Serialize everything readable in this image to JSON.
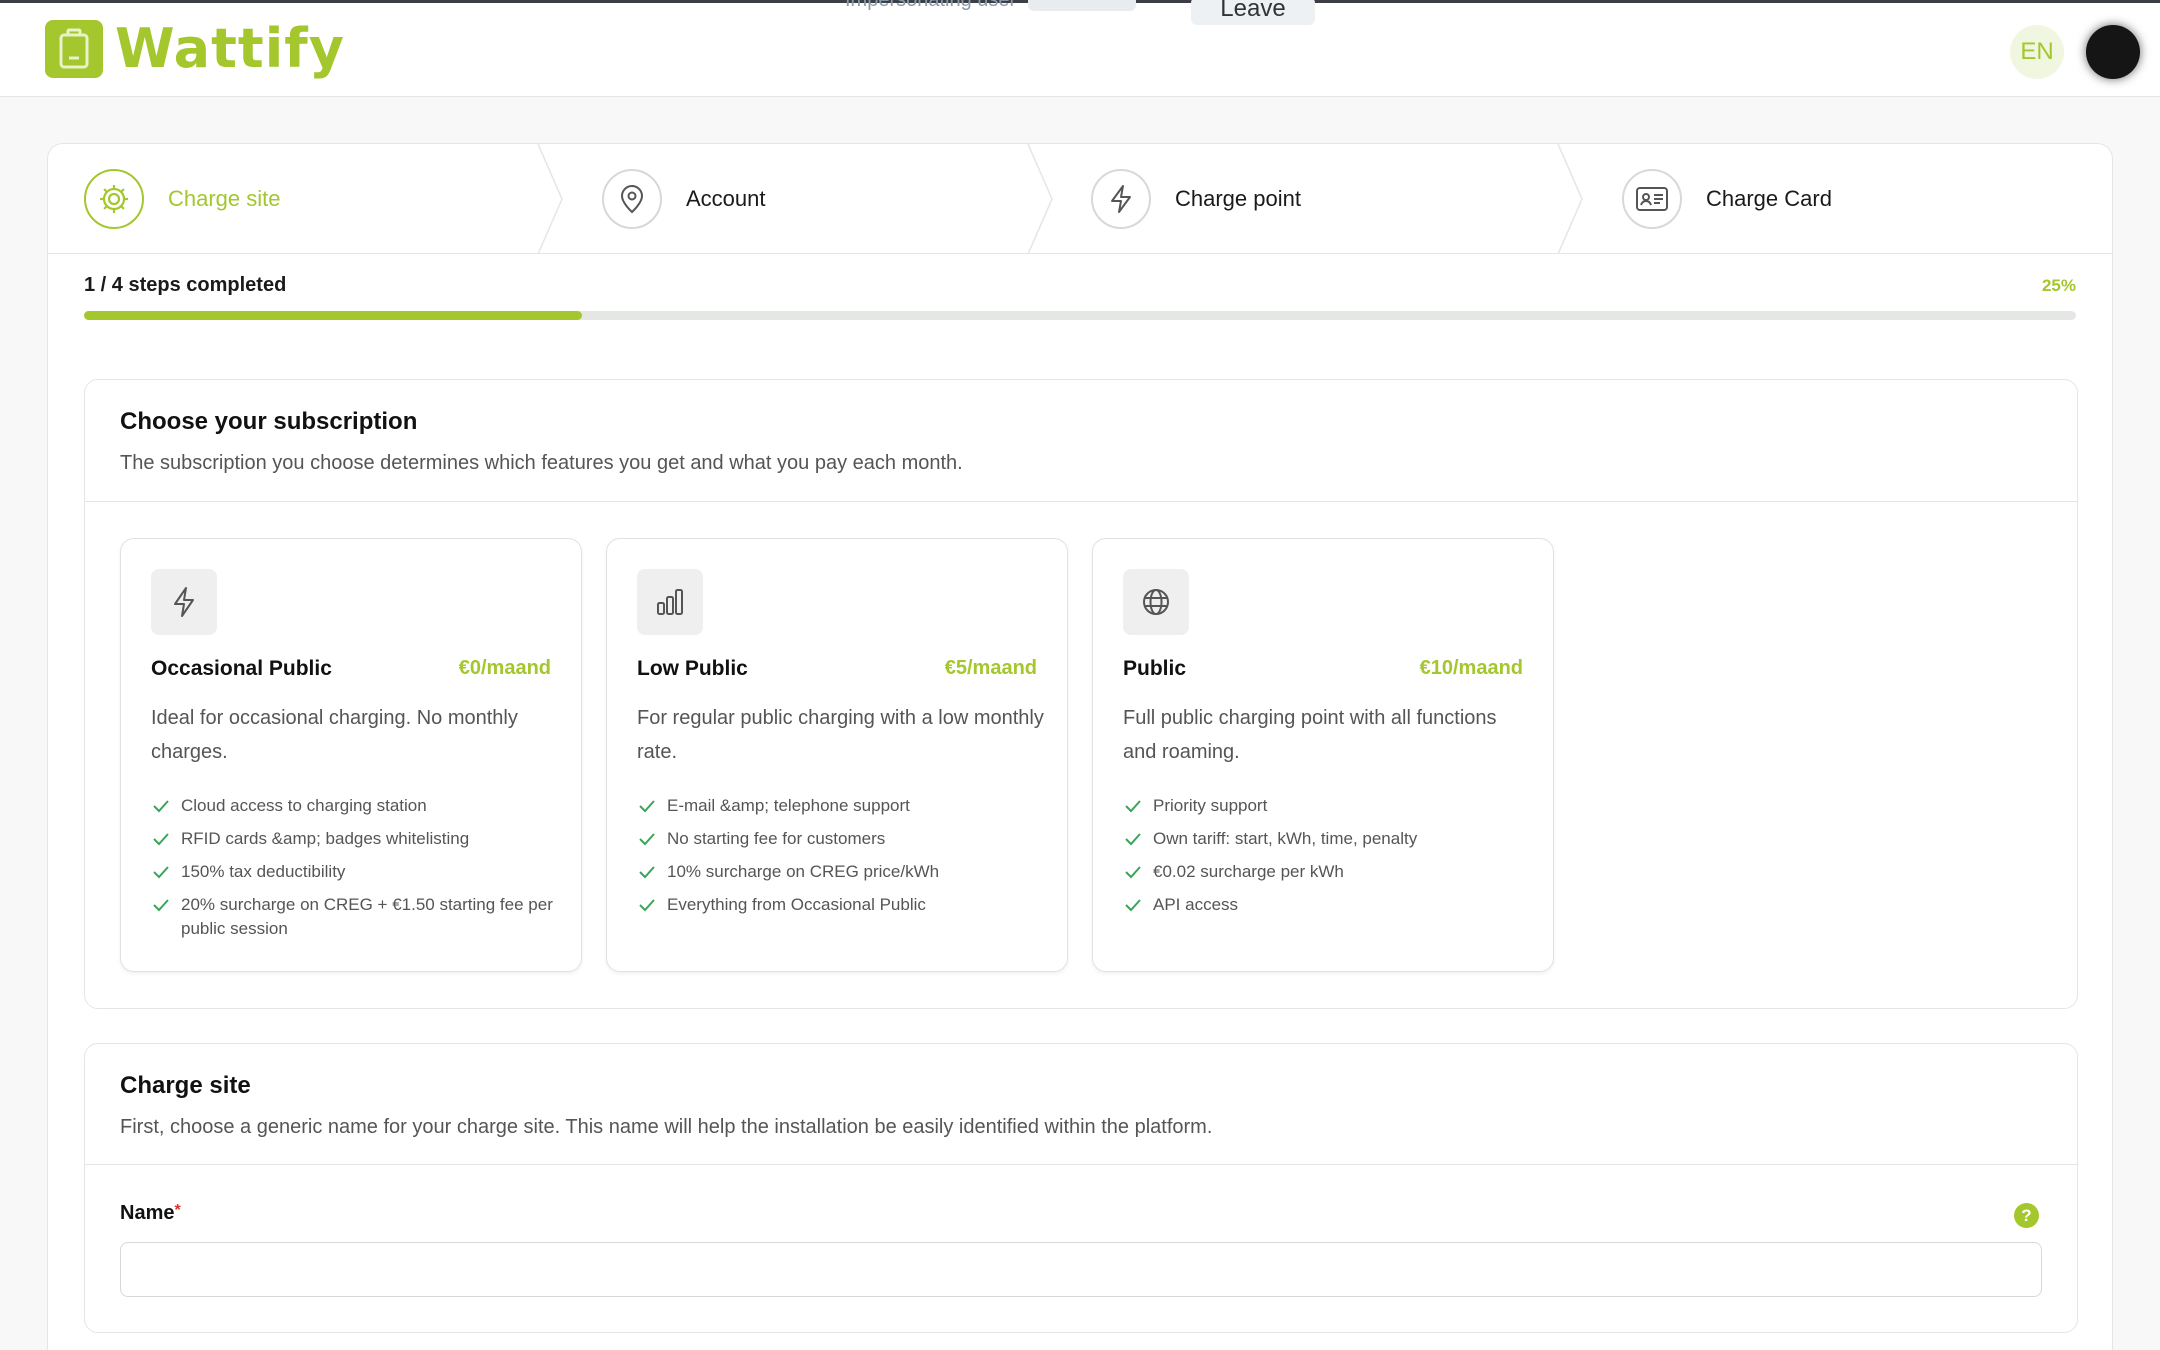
{
  "header": {
    "logo_text": "Wattify",
    "impersonate_text": "Impersonating user",
    "leave_label": "Leave",
    "language": "EN"
  },
  "steps": [
    {
      "label": "Charge site",
      "icon": "gear-icon",
      "active": true
    },
    {
      "label": "Account",
      "icon": "map-pin-icon",
      "active": false
    },
    {
      "label": "Charge point",
      "icon": "lightning-icon",
      "active": false
    },
    {
      "label": "Charge Card",
      "icon": "id-card-icon",
      "active": false
    }
  ],
  "progress": {
    "text": "1 / 4 steps completed",
    "percent_label": "25%",
    "fraction": 0.25
  },
  "subscription": {
    "title": "Choose your subscription",
    "description": "The subscription you choose determines which features you get and what you pay each month.",
    "plans": [
      {
        "name": "Occasional Public",
        "price": "€0/maand",
        "icon": "lightning-icon",
        "description": "Ideal for occasional charging. No monthly charges.",
        "features": [
          "Cloud access to charging station",
          "RFID cards &amp; badges whitelisting",
          "150% tax deductibility",
          "20% surcharge on CREG + €1.50 starting fee per public session"
        ]
      },
      {
        "name": "Low Public",
        "price": "€5/maand",
        "icon": "bar-chart-icon",
        "description": "For regular public charging with a low monthly rate.",
        "features": [
          "E-mail &amp; telephone support",
          "No starting fee for customers",
          "10% surcharge on CREG price/kWh",
          "Everything from Occasional Public"
        ]
      },
      {
        "name": "Public",
        "price": "€10/maand",
        "icon": "globe-icon",
        "description": "Full public charging point with all functions and roaming.",
        "features": [
          "Priority support",
          "Own tariff: start, kWh, time, penalty",
          "€0.02 surcharge per kWh",
          "API access"
        ]
      }
    ]
  },
  "charge_site": {
    "title": "Charge site",
    "description": "First, choose a generic name for your charge site. This name will help the installation be easily identified within the platform.",
    "name_label": "Name",
    "required_mark": "*",
    "help_label": "?",
    "name_value": "",
    "name_placeholder": ""
  },
  "colors": {
    "accent": "#a4c72d",
    "required": "#d9342b",
    "check": "#3aa55a"
  }
}
